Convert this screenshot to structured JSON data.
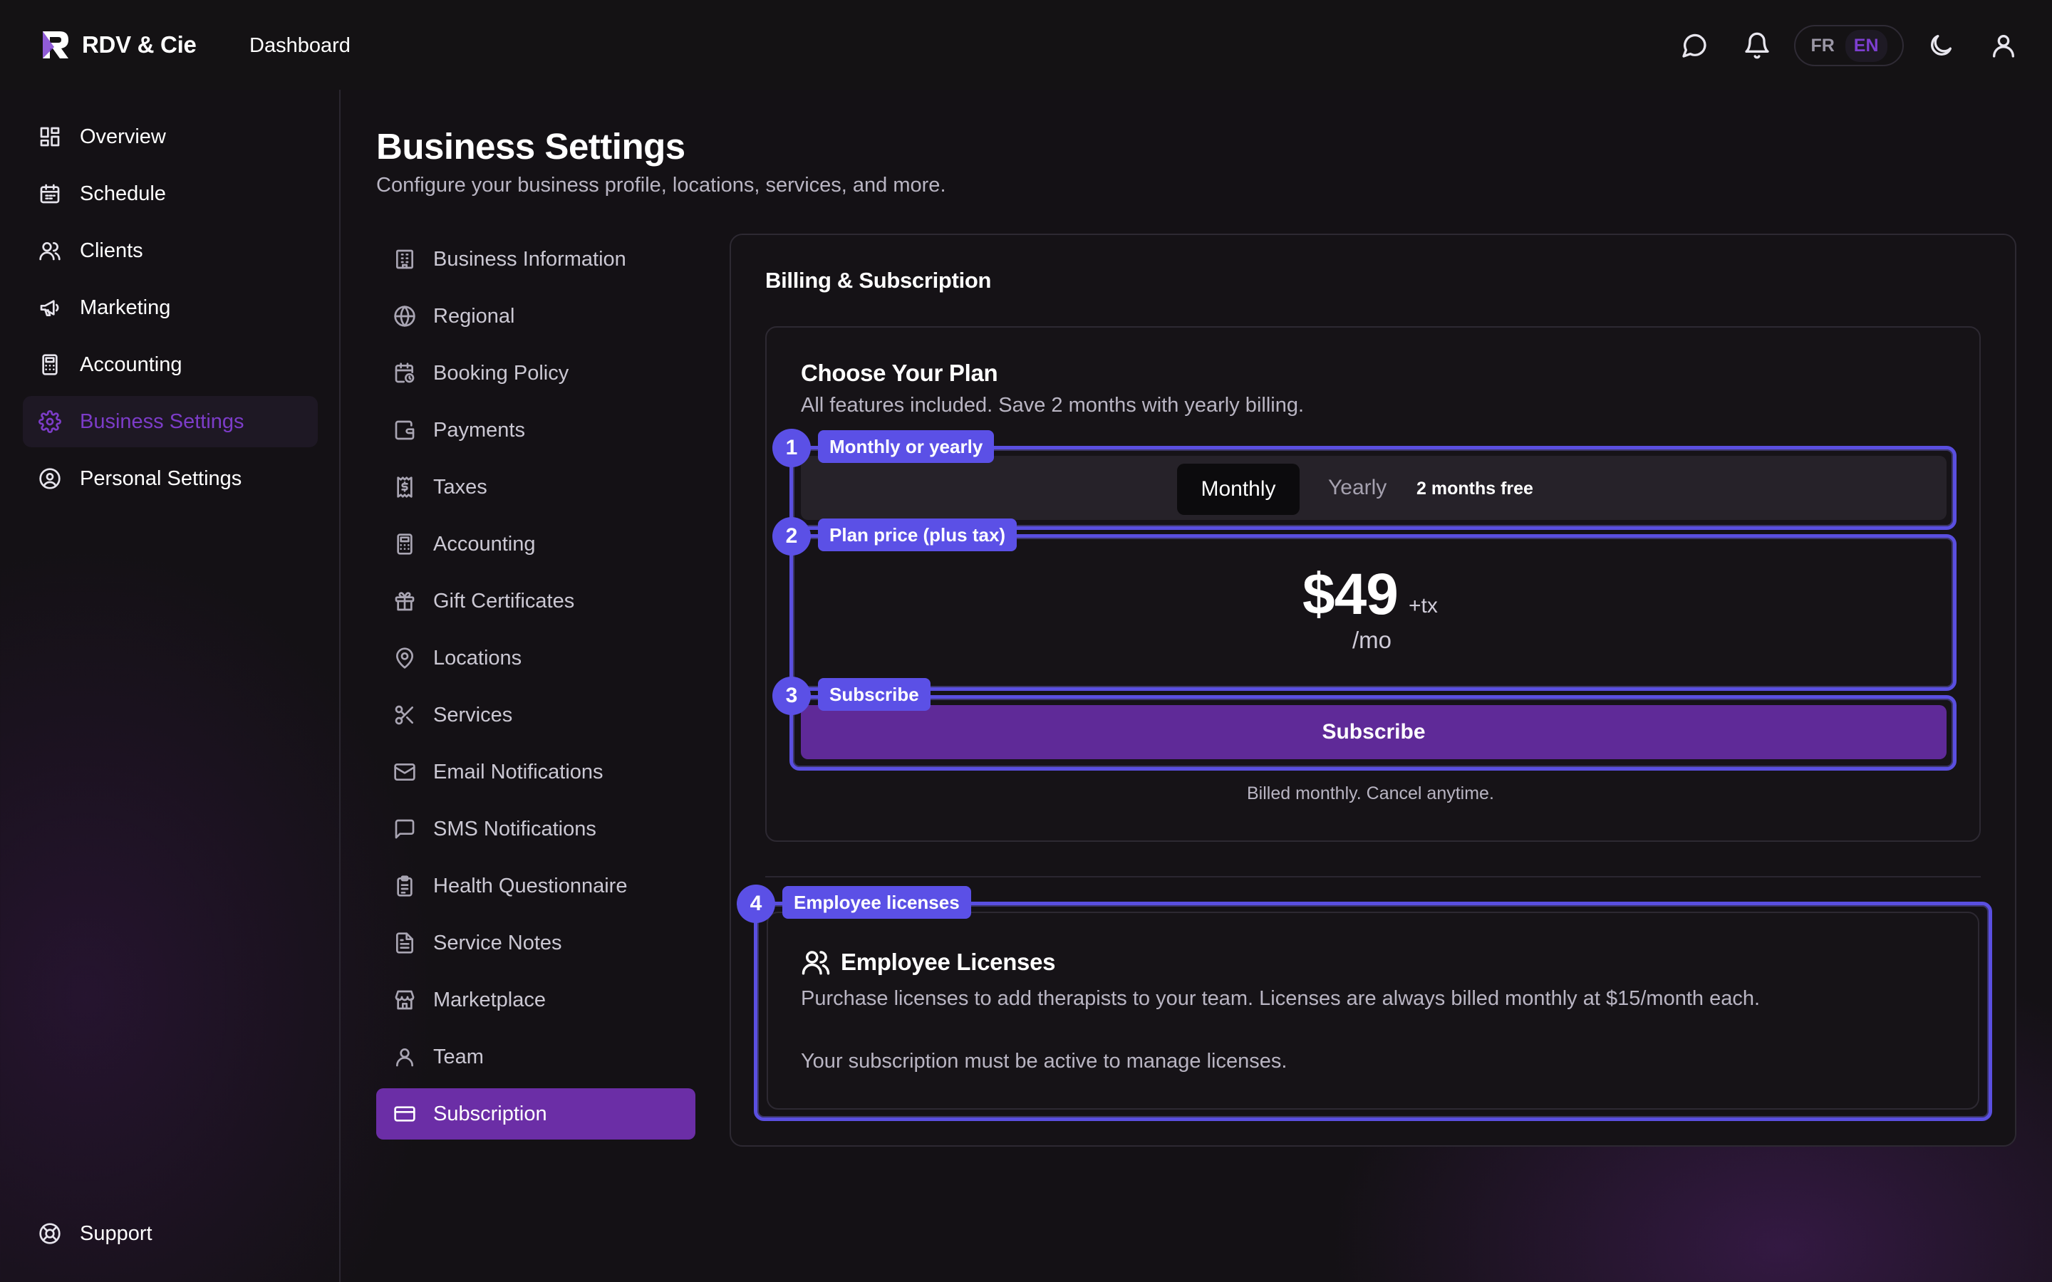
{
  "header": {
    "brand": "RDV & Cie",
    "nav_link": "Dashboard",
    "lang_fr": "FR",
    "lang_en": "EN"
  },
  "sidebar": {
    "items": [
      {
        "label": "Overview",
        "icon": "grid-icon"
      },
      {
        "label": "Schedule",
        "icon": "calendar-icon"
      },
      {
        "label": "Clients",
        "icon": "users-icon"
      },
      {
        "label": "Marketing",
        "icon": "megaphone-icon"
      },
      {
        "label": "Accounting",
        "icon": "calculator-icon"
      },
      {
        "label": "Business Settings",
        "icon": "gear-icon",
        "active": true
      },
      {
        "label": "Personal Settings",
        "icon": "user-circle-icon"
      }
    ],
    "support": "Support"
  },
  "page": {
    "title": "Business Settings",
    "subtitle": "Configure your business profile, locations, services, and more."
  },
  "settings_menu": {
    "items": [
      {
        "label": "Business Information",
        "icon": "building-icon"
      },
      {
        "label": "Regional",
        "icon": "globe-icon"
      },
      {
        "label": "Booking Policy",
        "icon": "calendar-clock-icon"
      },
      {
        "label": "Payments",
        "icon": "wallet-icon"
      },
      {
        "label": "Taxes",
        "icon": "receipt-dollar-icon"
      },
      {
        "label": "Accounting",
        "icon": "calculator-icon"
      },
      {
        "label": "Gift Certificates",
        "icon": "gift-icon"
      },
      {
        "label": "Locations",
        "icon": "map-pin-icon"
      },
      {
        "label": "Services",
        "icon": "scissors-icon"
      },
      {
        "label": "Email Notifications",
        "icon": "mail-icon"
      },
      {
        "label": "SMS Notifications",
        "icon": "message-square-icon"
      },
      {
        "label": "Health Questionnaire",
        "icon": "clipboard-icon"
      },
      {
        "label": "Service Notes",
        "icon": "file-text-icon"
      },
      {
        "label": "Marketplace",
        "icon": "store-icon"
      },
      {
        "label": "Team",
        "icon": "user-icon"
      },
      {
        "label": "Subscription",
        "icon": "credit-card-icon",
        "active": true
      }
    ]
  },
  "billing": {
    "title": "Billing & Subscription",
    "plan": {
      "title": "Choose Your Plan",
      "subtitle": "All features included. Save 2 months with yearly billing.",
      "toggle_monthly": "Monthly",
      "toggle_yearly": "Yearly",
      "yearly_badge": "2 months free",
      "price": "$49",
      "price_tax": "+tx",
      "price_period": "/mo",
      "subscribe_label": "Subscribe",
      "billed_note": "Billed monthly. Cancel anytime."
    },
    "licenses": {
      "title": "Employee Licenses",
      "description": "Purchase licenses to add therapists to your team. Licenses are always billed monthly at $15/month each.",
      "note": "Your subscription must be active to manage licenses."
    }
  },
  "annotations": [
    {
      "number": "1",
      "label": "Monthly or yearly"
    },
    {
      "number": "2",
      "label": "Plan price (plus tax)"
    },
    {
      "number": "3",
      "label": "Subscribe"
    },
    {
      "number": "4",
      "label": "Employee licenses"
    }
  ],
  "colors": {
    "accent": "#6b2ea6",
    "annotation": "#5b50e6",
    "background": "#141115"
  }
}
